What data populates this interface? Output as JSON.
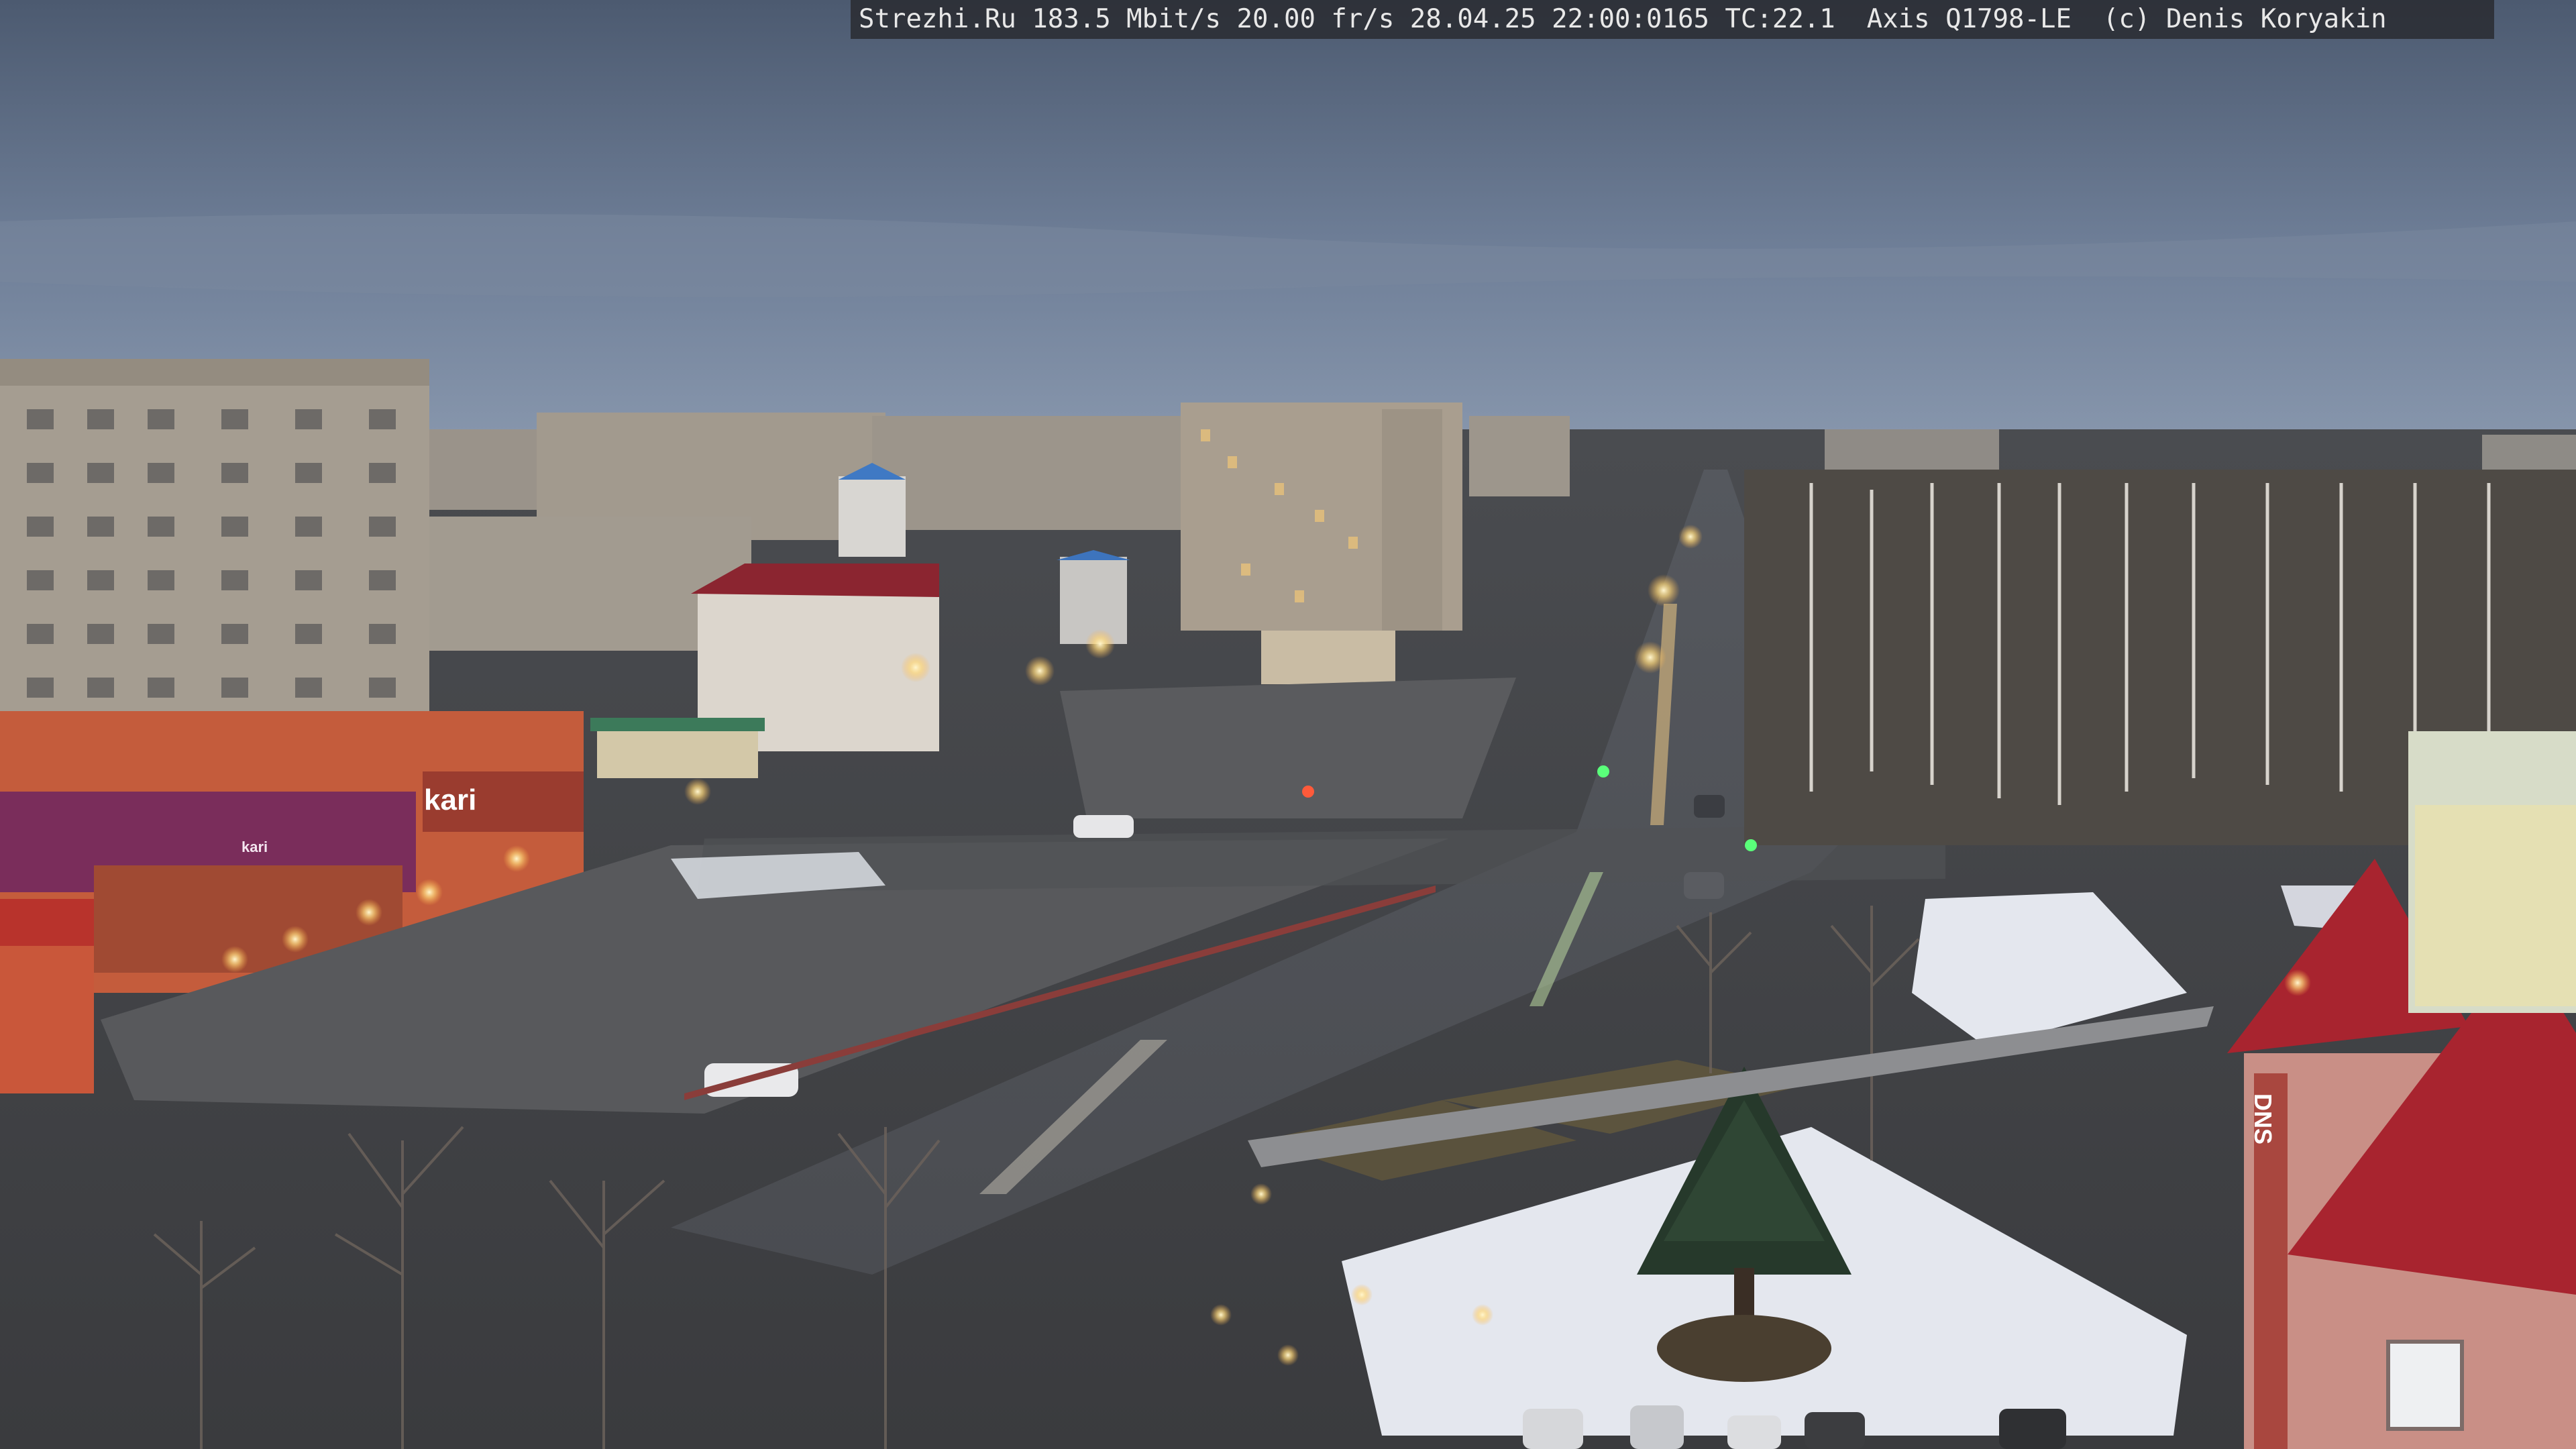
{
  "camera_overlay": {
    "text": "Strezhi.Ru 183.5 Mbit/s 20.00 fr/s 28.04.25 22:00:0165 TC:22.1  Axis Q1798-LE  (c) Denis Koryakin"
  },
  "signs": {
    "kari_main": "kari",
    "kari_secondary": "kari",
    "dns": "DNS"
  },
  "colors": {
    "sky_top": "#4f5d72",
    "sky_bottom": "#7b8aa3",
    "snow": "#e4e7ee",
    "kari_sign": "#7a2d5b",
    "roof_red": "#a8242f"
  }
}
